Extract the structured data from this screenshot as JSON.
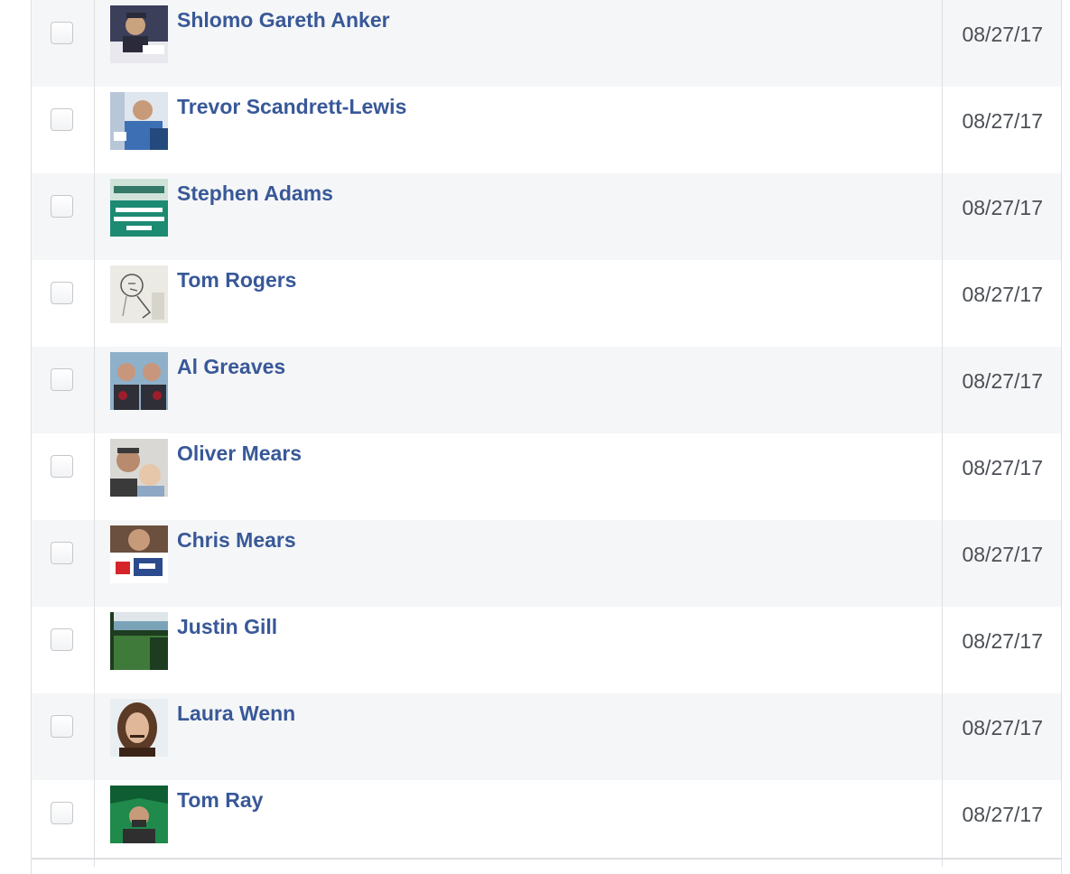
{
  "rows": [
    {
      "name": "Shlomo Gareth Anker",
      "date": "08/27/17",
      "avatar_icon": "profile-photo-man-reading",
      "avatar_colors": [
        "#3b3f5a",
        "#c9a27e",
        "#e8e8ee",
        "#2b2a3a"
      ]
    },
    {
      "name": "Trevor Scandrett-Lewis",
      "date": "08/27/17",
      "avatar_icon": "profile-photo-man-blue-shirt",
      "avatar_colors": [
        "#dfe6ee",
        "#3d6fb5",
        "#c79a7a",
        "#244a7d"
      ]
    },
    {
      "name": "Stephen Adams",
      "date": "08/27/17",
      "avatar_icon": "daily-mail-migrants-welcome-sign",
      "avatar_colors": [
        "#cfe3d8",
        "#1d8a72",
        "#ffffff",
        "#0e5e4c"
      ]
    },
    {
      "name": "Tom Rogers",
      "date": "08/27/17",
      "avatar_icon": "pencil-sketch-drawing",
      "avatar_colors": [
        "#eceae4",
        "#9c9c9c",
        "#555555",
        "#d7d4cb"
      ]
    },
    {
      "name": "Al Greaves",
      "date": "08/27/17",
      "avatar_icon": "two-men-red-rosettes",
      "avatar_colors": [
        "#8fb0c9",
        "#c8967c",
        "#a01d2b",
        "#2f2f38"
      ]
    },
    {
      "name": "Oliver Mears",
      "date": "08/27/17",
      "avatar_icon": "man-and-baby-selfie",
      "avatar_colors": [
        "#d9d8d4",
        "#b88a6e",
        "#e6c7a9",
        "#3a3a3a"
      ]
    },
    {
      "name": "Chris Mears",
      "date": "08/27/17",
      "avatar_icon": "man-holding-campaign-sign",
      "avatar_colors": [
        "#6b4f3f",
        "#ffffff",
        "#d6252a",
        "#2c4a8e"
      ]
    },
    {
      "name": "Justin Gill",
      "date": "08/27/17",
      "avatar_icon": "football-pitch-photo",
      "avatar_colors": [
        "#dfe5e8",
        "#3f7a3a",
        "#1e3c1f",
        "#7aa3b8"
      ]
    },
    {
      "name": "Laura Wenn",
      "date": "08/27/17",
      "avatar_icon": "woman-smiling-portrait",
      "avatar_colors": [
        "#e9eef2",
        "#5b3a26",
        "#e1b79a",
        "#3a2418"
      ]
    },
    {
      "name": "Tom Ray",
      "date": "08/27/17",
      "avatar_icon": "man-under-green-canopy",
      "avatar_colors": [
        "#1f8a4c",
        "#0f5e33",
        "#c79a7a",
        "#2f2f2f"
      ]
    }
  ]
}
